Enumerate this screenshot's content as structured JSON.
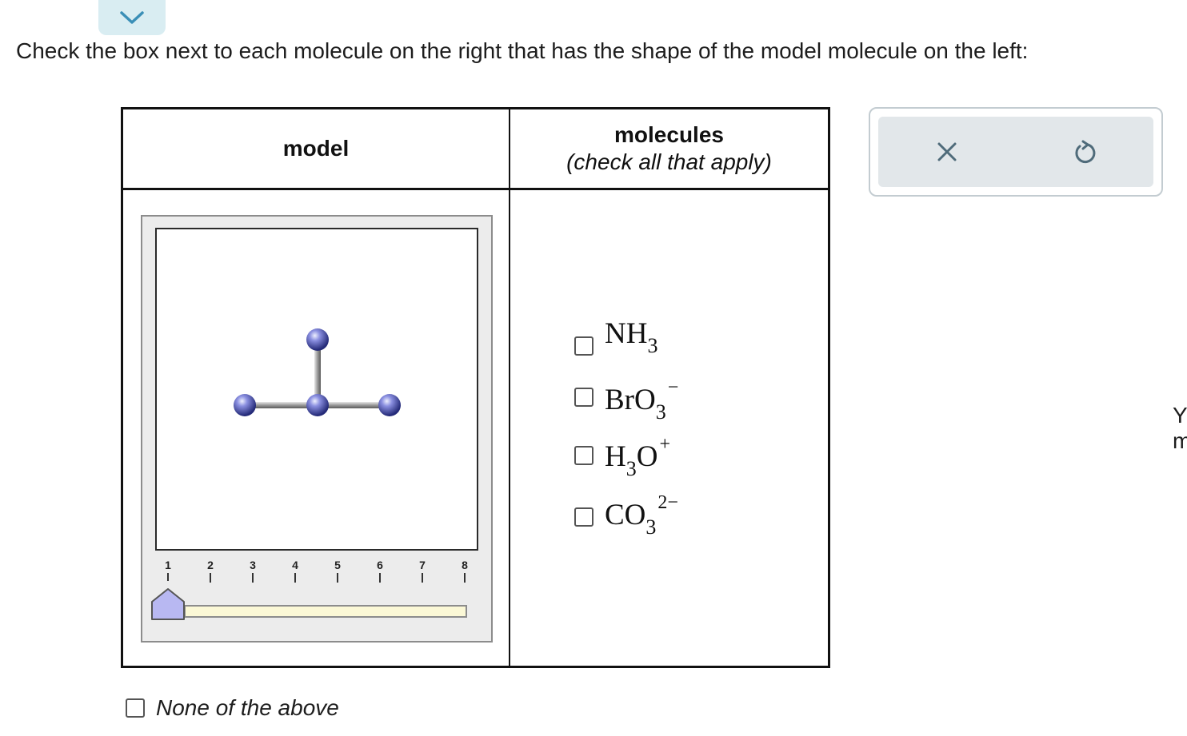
{
  "instruction": "Check the box next to each molecule on the right that has the shape of the model molecule on the left:",
  "table": {
    "model_header": "model",
    "molecules_header": "molecules",
    "molecules_subheader": "(check all that apply)"
  },
  "slider": {
    "ticks": [
      "1",
      "2",
      "3",
      "4",
      "5",
      "6",
      "7",
      "8"
    ],
    "selected": "1"
  },
  "molecules": [
    {
      "base": "NH",
      "sub": "3",
      "sup": "",
      "checked": false
    },
    {
      "base": "BrO",
      "sub": "3",
      "sup": "−",
      "checked": false
    },
    {
      "base": "H",
      "sub": "3",
      "mid": "O",
      "sup": "+",
      "checked": false
    },
    {
      "base": "CO",
      "sub": "3",
      "sup": "2−",
      "checked": false
    }
  ],
  "none_option": {
    "label": "None of the above",
    "checked": false
  },
  "actions": {
    "clear_icon": "x-icon",
    "reset_icon": "undo-icon"
  },
  "edge_text": [
    "Y",
    "m"
  ],
  "colors": {
    "accent_tab": "#d9edf2",
    "action_bg": "#e2e7ea",
    "icon": "#4f6b7a",
    "atom": "#5a5fb8",
    "slider_handle": "#b8b8f2",
    "slider_track": "#fbf8d6"
  }
}
